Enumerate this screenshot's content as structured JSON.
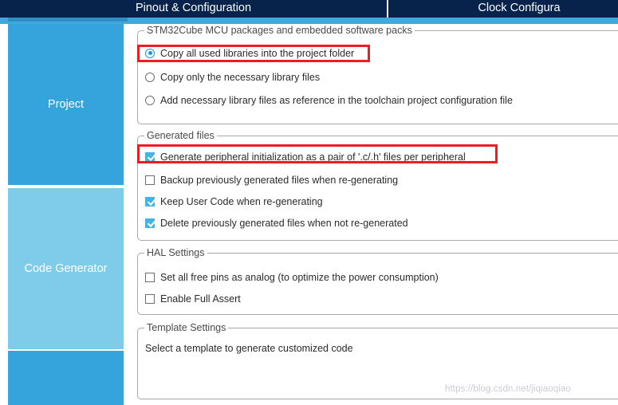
{
  "header": {
    "tabs": [
      {
        "label": "Pinout & Configuration",
        "selected": true
      },
      {
        "label": "Clock Configura",
        "selected": false
      }
    ],
    "accent_color": "#3fa9dd",
    "bar_color": "#07234b"
  },
  "sidebar": {
    "items": [
      {
        "label": "Project",
        "state": "selected",
        "color": "#35a4dc"
      },
      {
        "label": "Code Generator",
        "state": "active",
        "color": "#7fcbea"
      },
      {
        "label": "",
        "state": "normal",
        "color": "#35a4dc"
      }
    ]
  },
  "main": {
    "groups": [
      {
        "title": "STM32Cube MCU packages and embedded software packs",
        "options": [
          {
            "type": "radio",
            "checked": true,
            "label": "Copy all used libraries into the project folder"
          },
          {
            "type": "radio",
            "checked": false,
            "label": "Copy only the necessary library files"
          },
          {
            "type": "radio",
            "checked": false,
            "label": "Add necessary library files as reference in the toolchain project configuration file"
          }
        ]
      },
      {
        "title": "Generated files",
        "options": [
          {
            "type": "checkbox",
            "checked": true,
            "label": "Generate peripheral initialization as a pair of '.c/.h' files per peripheral"
          },
          {
            "type": "checkbox",
            "checked": false,
            "label": "Backup previously generated files when re-generating"
          },
          {
            "type": "checkbox",
            "checked": true,
            "label": "Keep User Code when re-generating"
          },
          {
            "type": "checkbox",
            "checked": true,
            "label": "Delete previously generated files when not re-generated"
          }
        ]
      },
      {
        "title": "HAL Settings",
        "options": [
          {
            "type": "checkbox",
            "checked": false,
            "label": "Set all free pins as analog (to optimize the power consumption)"
          },
          {
            "type": "checkbox",
            "checked": false,
            "label": "Enable Full Assert"
          }
        ]
      },
      {
        "title": "Template Settings",
        "text": "Select a template to generate customized code"
      }
    ]
  },
  "annotations": {
    "color": "#ee1d23",
    "boxes": [
      {
        "target": "Copy all used libraries into the project folder"
      },
      {
        "target": "Generate peripheral initialization as a pair of '.c/.h' files per peripheral"
      }
    ]
  },
  "watermark": {
    "text": "https://blog.csdn.net/jiqiaoqiao"
  }
}
